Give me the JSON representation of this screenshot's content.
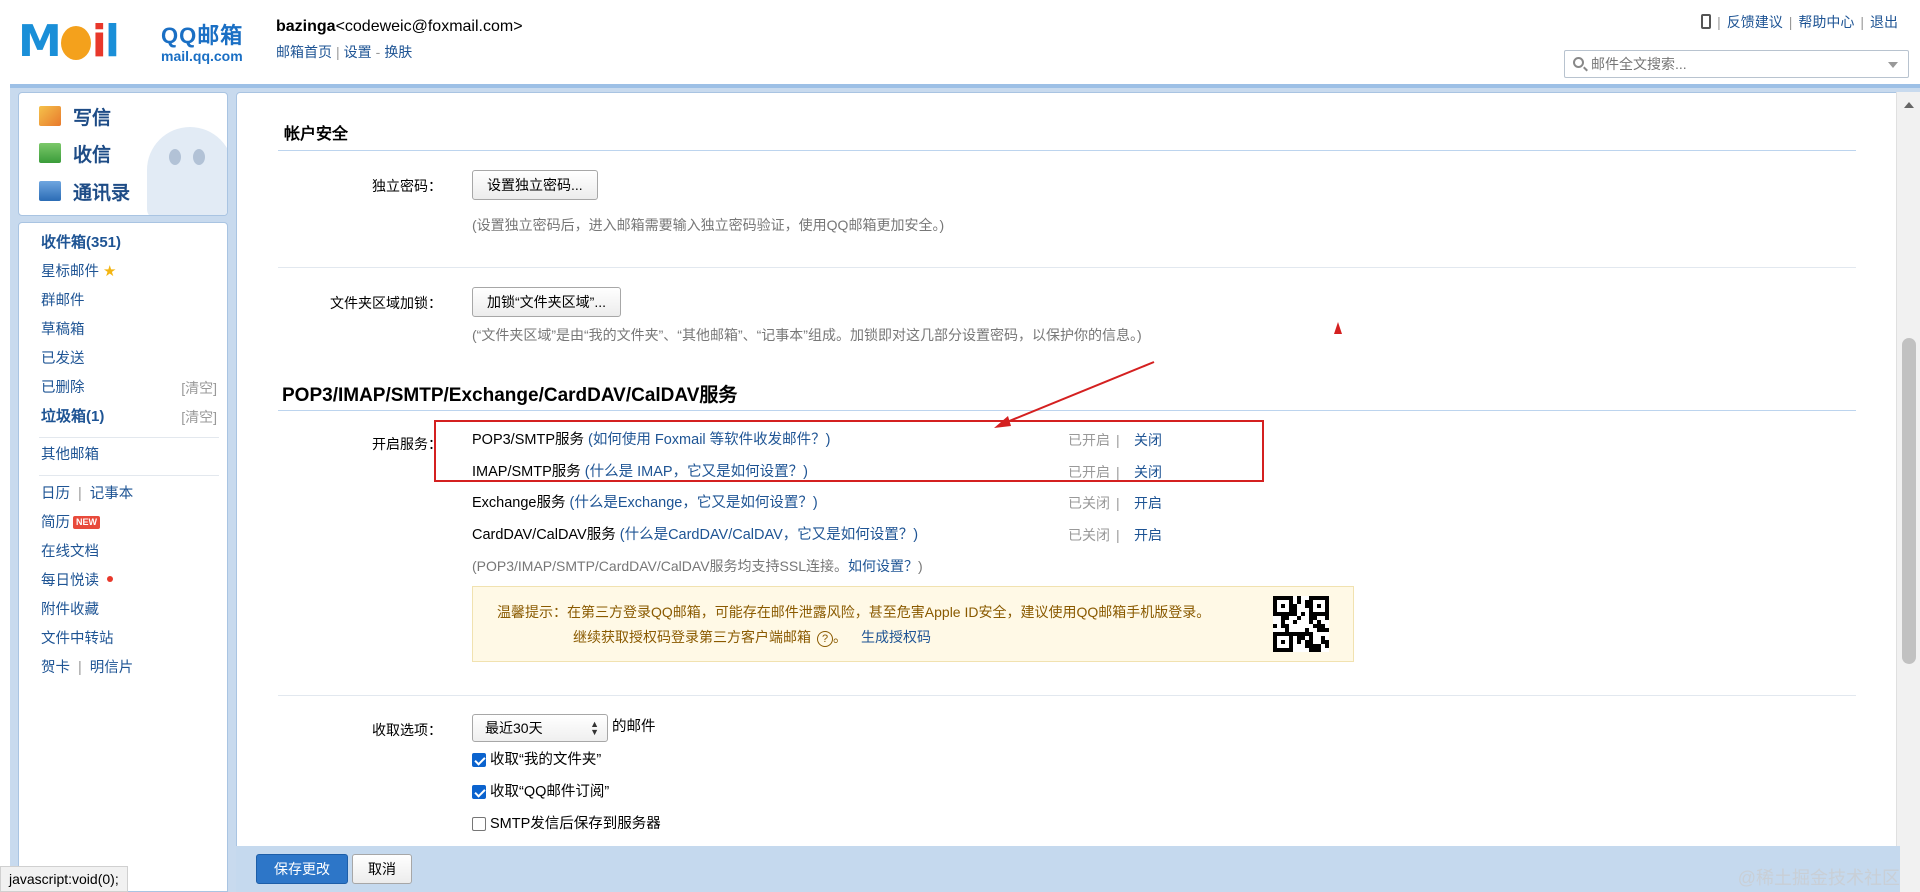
{
  "header": {
    "logo_text": "MOil",
    "brand": "QQ邮箱",
    "site": "mail.qq.com",
    "user_name": "bazinga",
    "user_email": "<codeweic@foxmail.com>",
    "links": [
      "邮箱首页",
      "设置",
      "换肤"
    ],
    "top_links": [
      "反馈建议",
      "帮助中心",
      "退出"
    ],
    "search_placeholder": "邮件全文搜索..."
  },
  "sidebar": {
    "quick": [
      {
        "label": "写信",
        "icon": "compose-icon"
      },
      {
        "label": "收信",
        "icon": "inbox-download-icon"
      },
      {
        "label": "通讯录",
        "icon": "contacts-icon"
      }
    ],
    "folders": [
      {
        "label": "收件箱(351)",
        "bold": true
      },
      {
        "label": "星标邮件"
      },
      {
        "label": "群邮件"
      },
      {
        "label": "草稿箱"
      },
      {
        "label": "已发送"
      },
      {
        "label": "已删除",
        "action": "[清空]"
      },
      {
        "label": "垃圾箱(1)",
        "bold": true,
        "action": "[清空]"
      },
      {
        "label": "其他邮箱"
      }
    ],
    "apps": {
      "calendar": "日历",
      "notes": "记事本",
      "resume": "简历",
      "new_badge": "NEW",
      "docs": "在线文档",
      "daily": "每日悦读",
      "attachments": "附件收藏",
      "transfer": "文件中转站",
      "cards": "贺卡",
      "postcards": "明信片"
    }
  },
  "main": {
    "account_security": {
      "title": "帐户安全",
      "independent_password_label": "独立密码：",
      "independent_password_button": "设置独立密码...",
      "independent_password_hint": "(设置独立密码后，进入邮箱需要输入独立密码验证，使用QQ邮箱更加安全。)",
      "folder_lock_label": "文件夹区域加锁：",
      "folder_lock_button": "加锁“文件夹区域”...",
      "folder_lock_hint": "(“文件夹区域”是由“我的文件夹”、“其他邮箱”、“记事本”组成。加锁即对这几部分设置密码，以保护你的信息。)"
    },
    "services": {
      "title": "POP3/IMAP/SMTP/Exchange/CardDAV/CalDAV服务",
      "enable_label": "开启服务：",
      "items": [
        {
          "name": "POP3/SMTP服务",
          "help": "(如何使用 Foxmail 等软件收发邮件？)",
          "status": "已开启",
          "action": "关闭"
        },
        {
          "name": "IMAP/SMTP服务",
          "help": "(什么是 IMAP，它又是如何设置？)",
          "status": "已开启",
          "action": "关闭"
        },
        {
          "name": "Exchange服务",
          "help": "(什么是Exchange，它又是如何设置？)",
          "status": "已关闭",
          "action": "开启"
        },
        {
          "name": "CardDAV/CalDAV服务",
          "help": "(什么是CardDAV/CalDAV，它又是如何设置？)",
          "status": "已关闭",
          "action": "开启"
        }
      ],
      "ssl_hint": "(POP3/IMAP/SMTP/CardDAV/CalDAV服务均支持SSL连接。",
      "ssl_link": "如何设置？",
      "ssl_end": ")",
      "tip_line1": "温馨提示：在第三方登录QQ邮箱，可能存在邮件泄露风险，甚至危害Apple ID安全，建议使用QQ邮箱手机版登录。",
      "tip_line2": "继续获取授权码登录第三方客户端邮箱",
      "tip_q": "?",
      "tip_dot": "。",
      "tip_link": "生成授权码"
    },
    "fetch": {
      "label": "收取选项：",
      "range": "最近30天",
      "suffix": "的邮件",
      "options": [
        {
          "label": "收取“我的文件夹”",
          "checked": true
        },
        {
          "label": "收取“QQ邮件订阅”",
          "checked": true
        },
        {
          "label": "SMTP发信后保存到服务器",
          "checked": false
        }
      ]
    },
    "buttons": {
      "save": "保存更改",
      "cancel": "取消"
    }
  },
  "statusbar": "javascript:void(0);",
  "watermark": "@稀土掘金技术社区",
  "colors": {
    "accent": "#2d76c8",
    "link": "#1e5494",
    "annotation": "#d42020",
    "tip_bg": "#fff9e6"
  }
}
